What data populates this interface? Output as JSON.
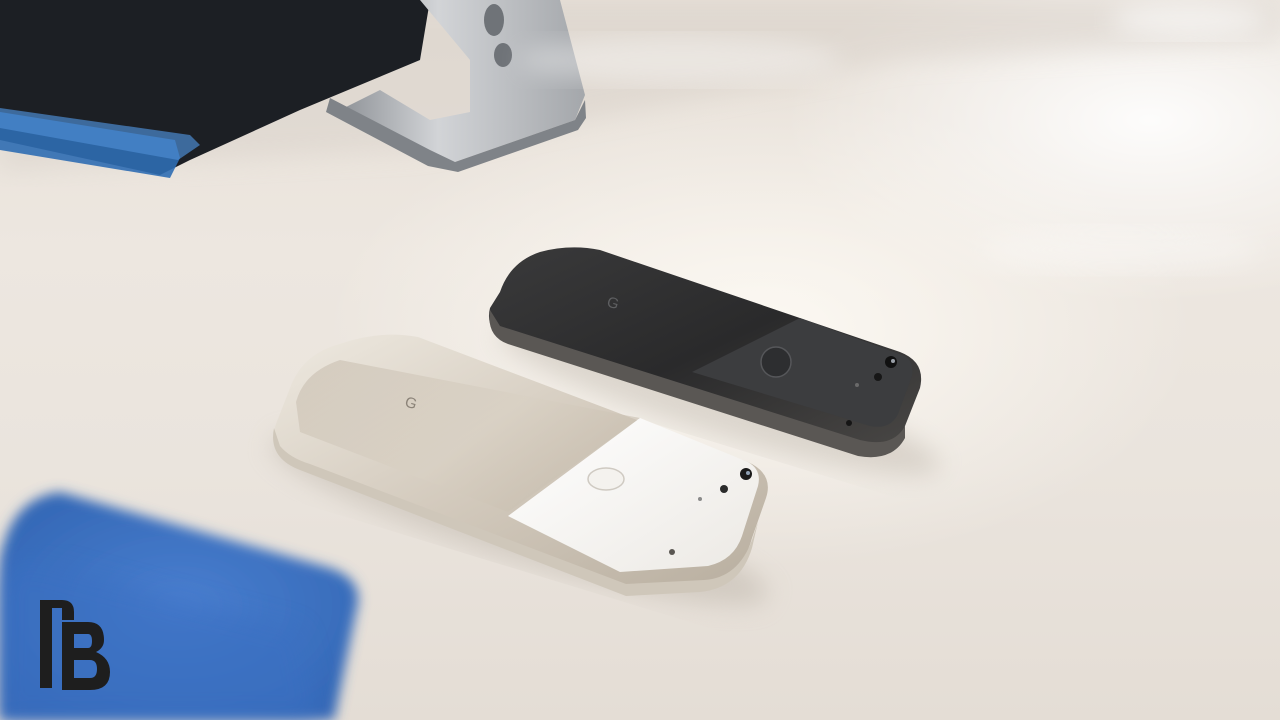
{
  "scene": {
    "description_tags": [
      "table-surface",
      "stand",
      "tablet",
      "silver-phone",
      "black-phone",
      "blue-phone",
      "watermark-logo"
    ],
    "colors": {
      "table": "#ebe5de",
      "stand_metal": "#b9bcc0",
      "tablet_dark": "#1c1f24",
      "tablet_edge_blue": "#3f7fc4",
      "silver_phone_body": "#d8d0c4",
      "silver_phone_glass": "#f3f1ed",
      "black_phone_body": "#2d2d2d",
      "black_phone_glass": "#3a3b3d",
      "blue_phone": "#3e75c8",
      "logo": "#1e1e1e"
    },
    "watermark": {
      "icon": "tb-logo-icon",
      "letters": "TB"
    }
  }
}
